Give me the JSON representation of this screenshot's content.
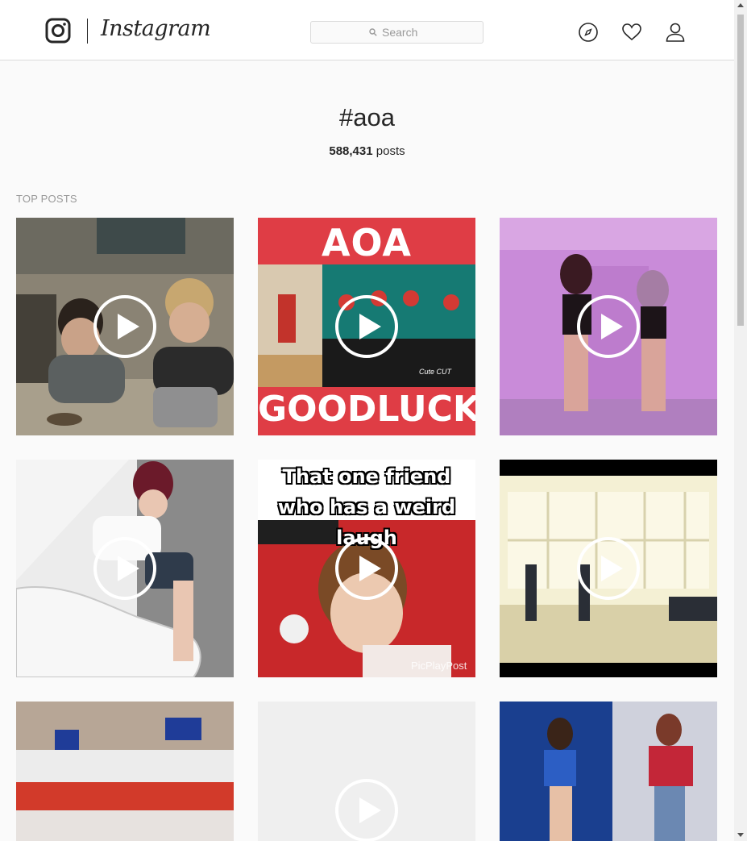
{
  "header": {
    "brand": "Instagram",
    "search_placeholder": "Search",
    "icons": [
      "compass-icon",
      "heart-icon",
      "user-icon"
    ]
  },
  "hashtag": {
    "title": "#aoa",
    "count": "588,431",
    "count_label": "posts"
  },
  "section_label": "TOP POSTS",
  "posts": [
    {
      "caption": "",
      "is_video": true
    },
    {
      "caption_top": "AOA",
      "caption_bottom": "GOODLUCK",
      "watermark": "Cute CUT",
      "is_video": true
    },
    {
      "caption": "",
      "is_video": true
    },
    {
      "caption": "",
      "is_video": true
    },
    {
      "caption_top": "That one friend who has a weird laugh",
      "watermark": "PicPlayPost",
      "is_video": true
    },
    {
      "caption": "",
      "is_video": true
    },
    {
      "caption": "",
      "is_video": false
    },
    {
      "caption": "",
      "is_video": true
    },
    {
      "caption": "",
      "is_video": false
    }
  ],
  "colors": {
    "background": "#fafafa",
    "text": "#262626",
    "border": "#dbdbdb",
    "muted": "#999999"
  }
}
